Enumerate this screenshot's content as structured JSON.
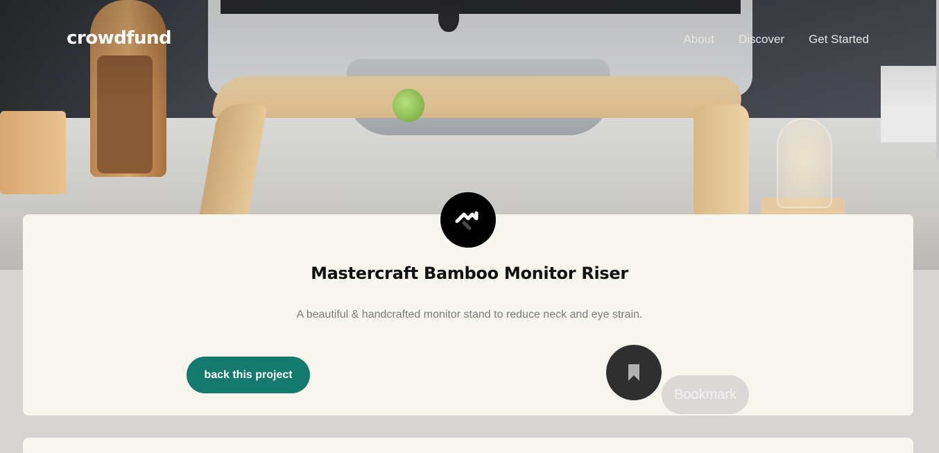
{
  "header": {
    "logo": "crowdfund",
    "nav": [
      "About",
      "Discover",
      "Get Started"
    ]
  },
  "project": {
    "logo_icon": "mastercraft-logo-icon",
    "title": "Mastercraft Bamboo Monitor Riser",
    "subtitle": "A beautiful & handcrafted monitor stand to reduce neck and eye strain.",
    "back_label": "back this project",
    "bookmark_label": "Bookmark",
    "bookmark_icon": "bookmark-icon"
  },
  "colors": {
    "primary": "#157a6e",
    "card_bg": "#f6f5ee",
    "page_bg": "#d8d3d3",
    "bookmark_circle": "#2f2f2f"
  }
}
